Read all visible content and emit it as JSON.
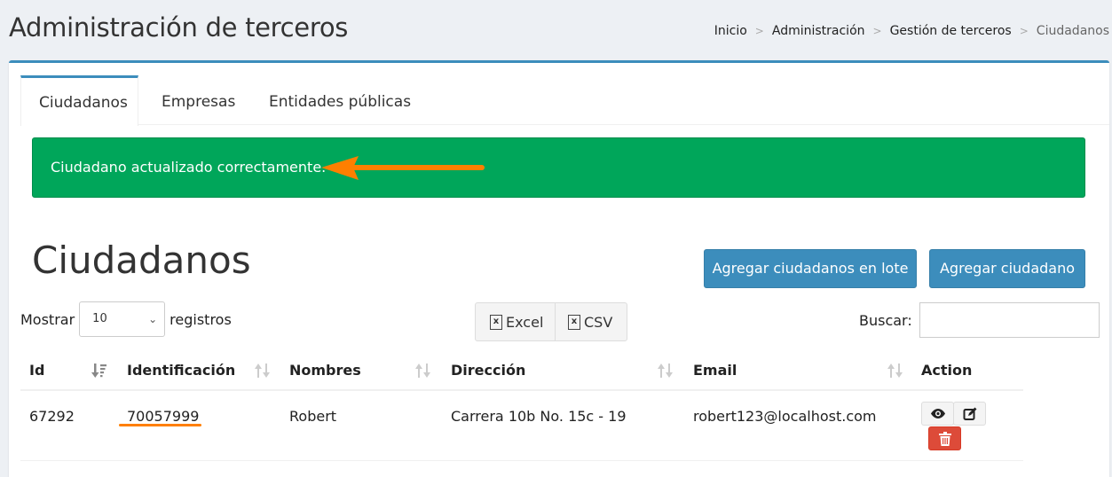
{
  "header": {
    "title": "Administración de terceros",
    "breadcrumb": [
      "Inicio",
      "Administración",
      "Gestión de terceros",
      "Ciudadanos"
    ]
  },
  "tabs": [
    {
      "label": "Ciudadanos",
      "active": true
    },
    {
      "label": "Empresas",
      "active": false
    },
    {
      "label": "Entidades públicas",
      "active": false
    }
  ],
  "alert": {
    "message": "Ciudadano actualizado correctamente.",
    "color": "#00a65a",
    "annotation_color": "#ff7f00"
  },
  "section": {
    "title": "Ciudadanos",
    "btn_lote": "Agregar ciudadanos en lote",
    "btn_add": "Agregar ciudadano"
  },
  "controls": {
    "show_label": "Mostrar",
    "page_size": "10",
    "records_label": "registros",
    "excel_label": "Excel",
    "csv_label": "CSV",
    "search_label": "Buscar:",
    "search_value": ""
  },
  "table": {
    "columns": [
      "Id",
      "Identificación",
      "Nombres",
      "Dirección",
      "Email",
      "Action"
    ],
    "rows": [
      {
        "id": "67292",
        "identificacion": "70057999",
        "nombres": "Robert",
        "direccion": "Carrera 10b No. 15c - 19",
        "email": "robert123@localhost.com"
      }
    ]
  },
  "icons": {
    "view": "eye-icon",
    "edit": "edit-icon",
    "delete": "trash-icon",
    "sort": "sort-icon",
    "file": "file-excel-icon"
  }
}
